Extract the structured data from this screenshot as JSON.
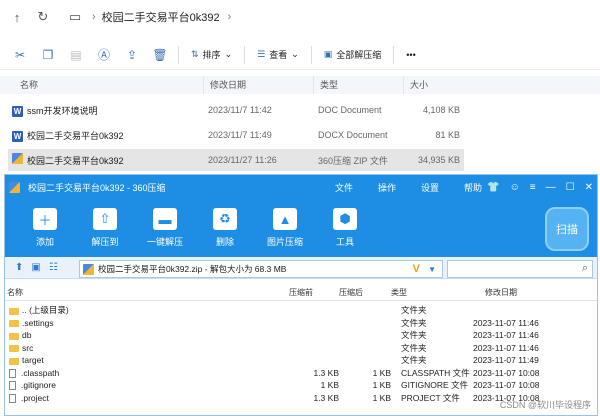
{
  "explorer": {
    "breadcrumb": "校园二手交易平台0k392",
    "toolbar": {
      "sort_label": "排序",
      "view_label": "查看",
      "extract_all_label": "全部解压缩",
      "more": "•••"
    },
    "columns": [
      "名称",
      "修改日期",
      "类型",
      "大小"
    ],
    "files": [
      {
        "name": "ssm开发环境说明",
        "date": "2023/11/7 11:42",
        "type": "DOC Document",
        "size": "4,108 KB",
        "icon": "word-icon"
      },
      {
        "name": "校园二手交易平台0k392",
        "date": "2023/11/7 11:49",
        "type": "DOCX Document",
        "size": "81 KB",
        "icon": "word-icon"
      },
      {
        "name": "校园二手交易平台0k392",
        "date": "2023/11/27 11:26",
        "type": "360压缩 ZIP 文件",
        "size": "34,935 KB",
        "icon": "zip-icon"
      }
    ]
  },
  "zip": {
    "title": "校园二手交易平台0k392 - 360压缩",
    "menu": [
      "文件",
      "操作",
      "设置",
      "帮助"
    ],
    "tools": [
      "添加",
      "解压到",
      "一键解压",
      "删除",
      "图片压缩",
      "工具"
    ],
    "scan_label": "扫描",
    "path": "校园二手交易平台0k392.zip - 解包大小为 68.3 MB",
    "columns": [
      "名称",
      "压缩前",
      "压缩后",
      "类型",
      "修改日期"
    ],
    "rows": [
      {
        "name": ".. (上级目录)",
        "before": "",
        "after": "",
        "type": "文件夹",
        "date": "",
        "kind": "folder"
      },
      {
        "name": ".settings",
        "before": "",
        "after": "",
        "type": "文件夹",
        "date": "2023-11-07 11:46",
        "kind": "folder"
      },
      {
        "name": "db",
        "before": "",
        "after": "",
        "type": "文件夹",
        "date": "2023-11-07 11:46",
        "kind": "folder"
      },
      {
        "name": "src",
        "before": "",
        "after": "",
        "type": "文件夹",
        "date": "2023-11-07 11:46",
        "kind": "folder"
      },
      {
        "name": "target",
        "before": "",
        "after": "",
        "type": "文件夹",
        "date": "2023-11-07 11:49",
        "kind": "folder"
      },
      {
        "name": ".classpath",
        "before": "1.3 KB",
        "after": "1 KB",
        "type": "CLASSPATH 文件",
        "date": "2023-11-07 10:08",
        "kind": "file"
      },
      {
        "name": ".gitignore",
        "before": "1 KB",
        "after": "1 KB",
        "type": "GITIGNORE 文件",
        "date": "2023-11-07 10:08",
        "kind": "file"
      },
      {
        "name": ".project",
        "before": "1.3 KB",
        "after": "1 KB",
        "type": "PROJECT 文件",
        "date": "2023-11-07 10:08",
        "kind": "file"
      }
    ]
  },
  "watermark": "CSDN @软川毕设程序"
}
